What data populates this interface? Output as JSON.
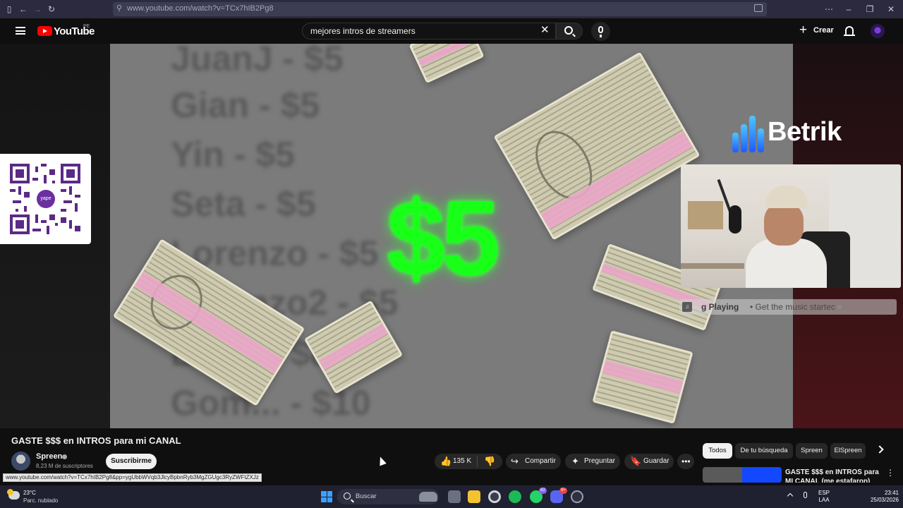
{
  "browser": {
    "url": "www.youtube.com/watch?v=TCx7hIB2Pg8"
  },
  "header": {
    "logo_text": "YouTube",
    "country_code": "PE",
    "search_query": "mejores intros de streamers",
    "create_label": "Crear"
  },
  "video_overlay": {
    "blurred_lines": [
      "JuanJ - $5",
      "Gian - $5",
      "Yin - $5",
      "Seta - $5",
      "Lorenzo - $5",
      "Lorenzo2 - $5",
      "Bra... - $8",
      "Gom... - $10"
    ],
    "price": "$5",
    "qr_logo_text": "yape",
    "sponsor": "Betrik",
    "now_playing_title": "g Playing",
    "now_playing_sub": "Get the music startec"
  },
  "video": {
    "title": "GASTE $$$ en INTROS para mi CANAL",
    "channel": "Spreen",
    "subscribers": "8,23 M de suscriptores",
    "subscribe_label": "Suscribirme",
    "likes": "135 K",
    "share_label": "Compartir",
    "ask_label": "Preguntar",
    "save_label": "Guardar"
  },
  "sidebar": {
    "chips": [
      "Todos",
      "De tu búsqueda",
      "Spreen",
      "ElSpreen"
    ],
    "recommendation_title": "GASTE $$$ en INTROS para MI CANAL (me estafaron)"
  },
  "status_url": "www.youtube.com/watch?v=TCx7hIB2Pg8&pp=ygUbbWVqb3JlcyBpbnRyb3MgZGUgc3RyZWFtZXJz",
  "taskbar": {
    "temperature": "23°C",
    "weather": "Parc. nublado",
    "search_label": "Buscar",
    "whatsapp_badge": "82",
    "discord_badge": "9+",
    "lang_line1": "ESP",
    "lang_line2": "LAA",
    "time": "23:41",
    "date": "25/03/2026"
  },
  "colors": {
    "accent_red": "#ff0000",
    "price_green": "#18ff18",
    "betrik_blue": "#1e5bff",
    "yape_purple": "#6b2fa0"
  }
}
